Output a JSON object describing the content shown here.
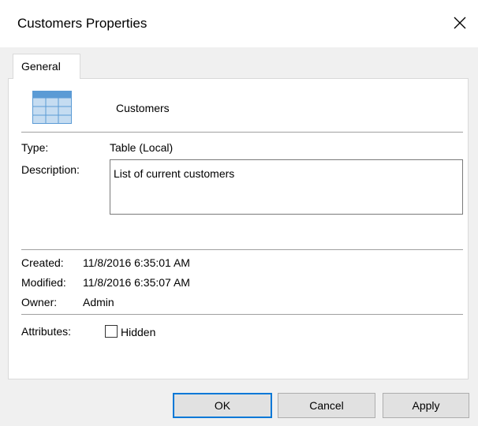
{
  "window": {
    "title": "Customers Properties"
  },
  "tabs": [
    {
      "label": "General"
    }
  ],
  "general": {
    "object_name": "Customers",
    "type_label": "Type:",
    "type_value": "Table (Local)",
    "description_label": "Description:",
    "description_value": "List of current customers",
    "created_label": "Created:",
    "created_value": "11/8/2016 6:35:01 AM",
    "modified_label": "Modified:",
    "modified_value": "11/8/2016 6:35:07 AM",
    "owner_label": "Owner:",
    "owner_value": "Admin",
    "attributes_label": "Attributes:",
    "hidden_label": "Hidden",
    "hidden_checked": false
  },
  "buttons": {
    "ok": "OK",
    "cancel": "Cancel",
    "apply": "Apply"
  },
  "icons": {
    "close": "close-icon",
    "table": "table-icon"
  },
  "colors": {
    "default_button_border": "#0078d7",
    "table_icon_header": "#5b9bd5",
    "table_icon_cells": "#c5dcf1"
  }
}
